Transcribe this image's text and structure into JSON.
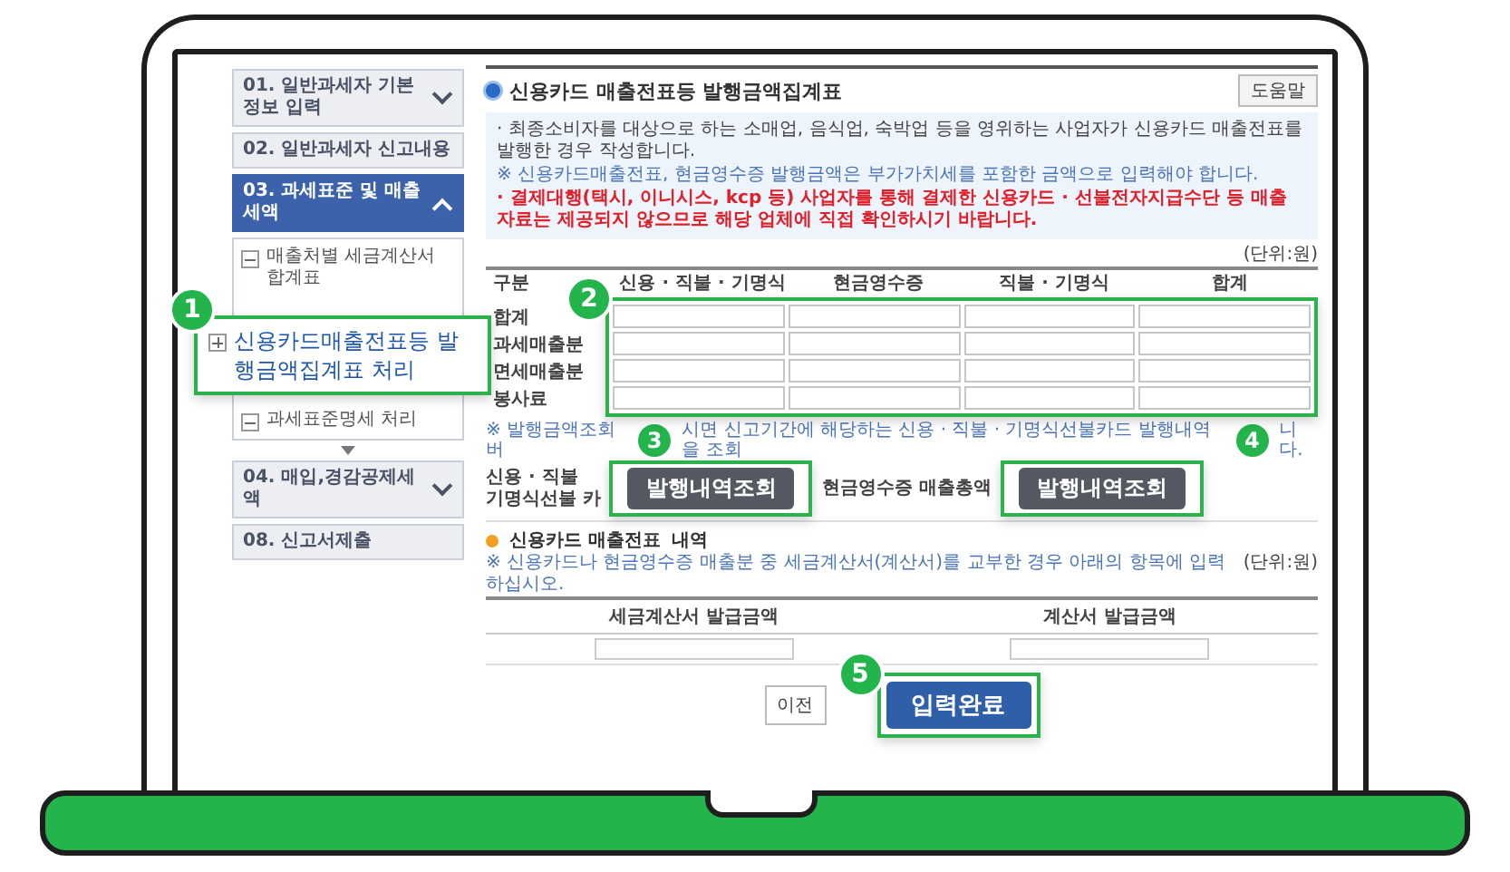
{
  "sidebar": {
    "items": [
      {
        "label": "01. 일반과세자 기본정보 입력",
        "kind": "group",
        "selected": false,
        "expanded": false
      },
      {
        "label": "02. 일반과세자 신고내용",
        "kind": "link",
        "selected": false
      },
      {
        "label": "03. 과세표준 및 매출세액",
        "kind": "group",
        "selected": true,
        "expanded": true,
        "more_below": true,
        "children": [
          {
            "label": "매출처별 세금계산서 합계표",
            "kind": "minus",
            "highlighted": false
          },
          {
            "label": "신용카드매출전표등 발행금액집계표 처리",
            "kind": "plus",
            "highlighted": true,
            "badge": "1"
          },
          {
            "label": "과세표준명세 처리",
            "kind": "minus",
            "highlighted": false
          }
        ]
      },
      {
        "label": "04. 매입,경감공제세액",
        "kind": "group",
        "selected": false,
        "expanded": false
      },
      {
        "label": "08. 신고서제출",
        "kind": "link",
        "selected": false
      }
    ]
  },
  "main": {
    "title": "신용카드 매출전표등 발행금액집계표",
    "help_button": "도움말",
    "notices": [
      {
        "kind": "bullet",
        "text": "· 최종소비자를 대상으로 하는 소매업, 음식업, 숙박업 등을 영위하는 사업자가 신용카드 매출전표를 발행한 경우 작성합니다."
      },
      {
        "kind": "note",
        "text": "※ 신용카드매출전표, 현금영수증 발행금액은 부가가치세를 포함한 금액으로 입력해야 합니다."
      },
      {
        "kind": "warning",
        "text": "· 결제대행(택시, 이니시스, kcp 등) 사업자를 통해 결제한 신용카드 · 선불전자지급수단 등 매출 자료는 제공되지 않으므로 해당 업체에 직접 확인하시기 바랍니다."
      }
    ],
    "unit": "(단위:원)",
    "summary": {
      "columns": [
        "구분",
        "신용 · 직불 · 기명식",
        "현금영수증",
        "직불 · 기명식",
        "합계"
      ],
      "rows": [
        "합계",
        "과세매출분",
        "면세매출분",
        "봉사료"
      ],
      "badge": "2"
    },
    "lookup": {
      "note_parts": [
        "※ 발행금액조회 버",
        "시면 신고기간에 해당하는 신용 · 직불 · 기명식선불카드 발행내역을 조회",
        "니다."
      ],
      "items": [
        {
          "label_lines": [
            "신용 · 직불",
            "기명식선불 카"
          ],
          "badge": "3",
          "button": "발행내역조회"
        },
        {
          "label_lines": [
            "현금영수증 매출총액"
          ],
          "badge": "4",
          "button": "발행내역조회"
        }
      ]
    },
    "invoice": {
      "heading_parts": [
        "신용카드 매출전표",
        "내역"
      ],
      "note": "※ 신용카드나 현금영수증 매출분 중 세금계산서(계산서)를 교부한 경우 아래의 항목에 입력하십시오.",
      "unit": "(단위:원)",
      "columns": [
        "세금계산서 발급금액",
        "계산서 발급금액"
      ]
    },
    "buttons": [
      {
        "label": "이전",
        "kind": "secondary"
      },
      {
        "label": "입력완료",
        "kind": "primary",
        "badge": "5"
      }
    ]
  }
}
